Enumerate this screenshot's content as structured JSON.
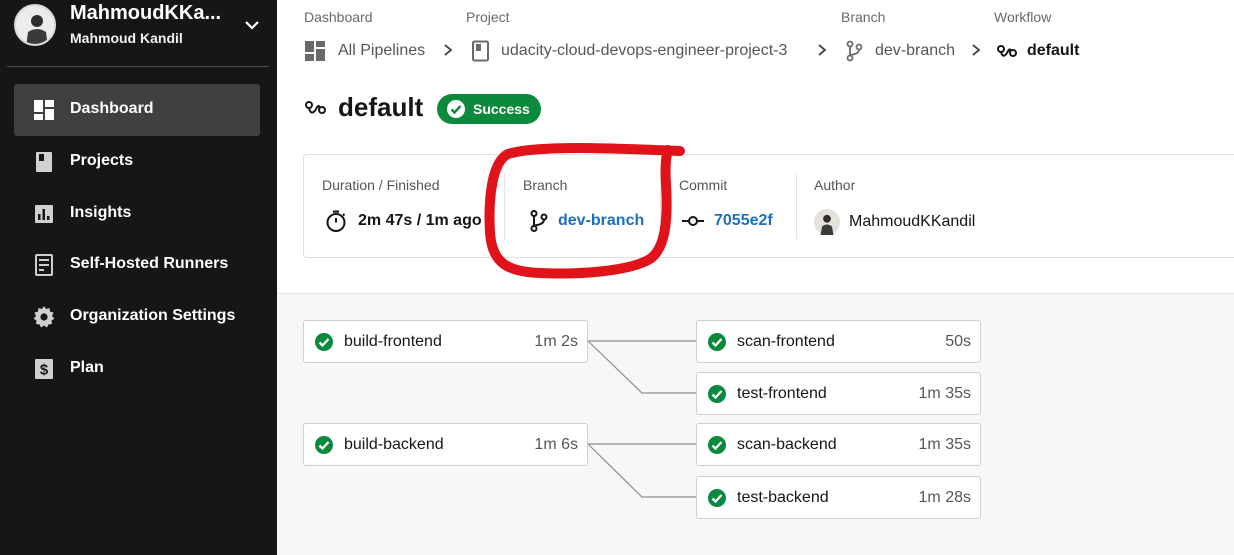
{
  "sidebar": {
    "org_name": "MahmoudKKa...",
    "org_user": "Mahmoud Kandil",
    "items": [
      {
        "label": "Dashboard",
        "icon": "dashboard-icon"
      },
      {
        "label": "Projects",
        "icon": "projects-icon"
      },
      {
        "label": "Insights",
        "icon": "insights-icon"
      },
      {
        "label": "Self-Hosted Runners",
        "icon": "runners-icon"
      },
      {
        "label": "Organization Settings",
        "icon": "settings-gear-icon"
      },
      {
        "label": "Plan",
        "icon": "plan-dollar-icon"
      }
    ]
  },
  "breadcrumb": {
    "headers": {
      "dashboard": "Dashboard",
      "project": "Project",
      "branch": "Branch",
      "workflow": "Workflow"
    },
    "items": {
      "pipelines": "All Pipelines",
      "project": "udacity-cloud-devops-engineer-project-3",
      "branch": "dev-branch",
      "workflow": "default"
    }
  },
  "workflow": {
    "title": "default",
    "status": "Success",
    "status_color": "#0b8a3e"
  },
  "info": {
    "duration_label": "Duration / Finished",
    "duration_value": "2m 47s / 1m ago",
    "branch_label": "Branch",
    "branch_value": "dev-branch",
    "commit_label": "Commit",
    "commit_value": "7055e2f",
    "author_label": "Author",
    "author_value": "MahmoudKKandil"
  },
  "annotation_color": "#e0121a",
  "jobs": [
    {
      "name": "build-frontend",
      "duration": "1m 2s",
      "status": "success"
    },
    {
      "name": "scan-frontend",
      "duration": "50s",
      "status": "success"
    },
    {
      "name": "test-frontend",
      "duration": "1m 35s",
      "status": "success"
    },
    {
      "name": "build-backend",
      "duration": "1m 6s",
      "status": "success"
    },
    {
      "name": "scan-backend",
      "duration": "1m 35s",
      "status": "success"
    },
    {
      "name": "test-backend",
      "duration": "1m 28s",
      "status": "success"
    }
  ]
}
